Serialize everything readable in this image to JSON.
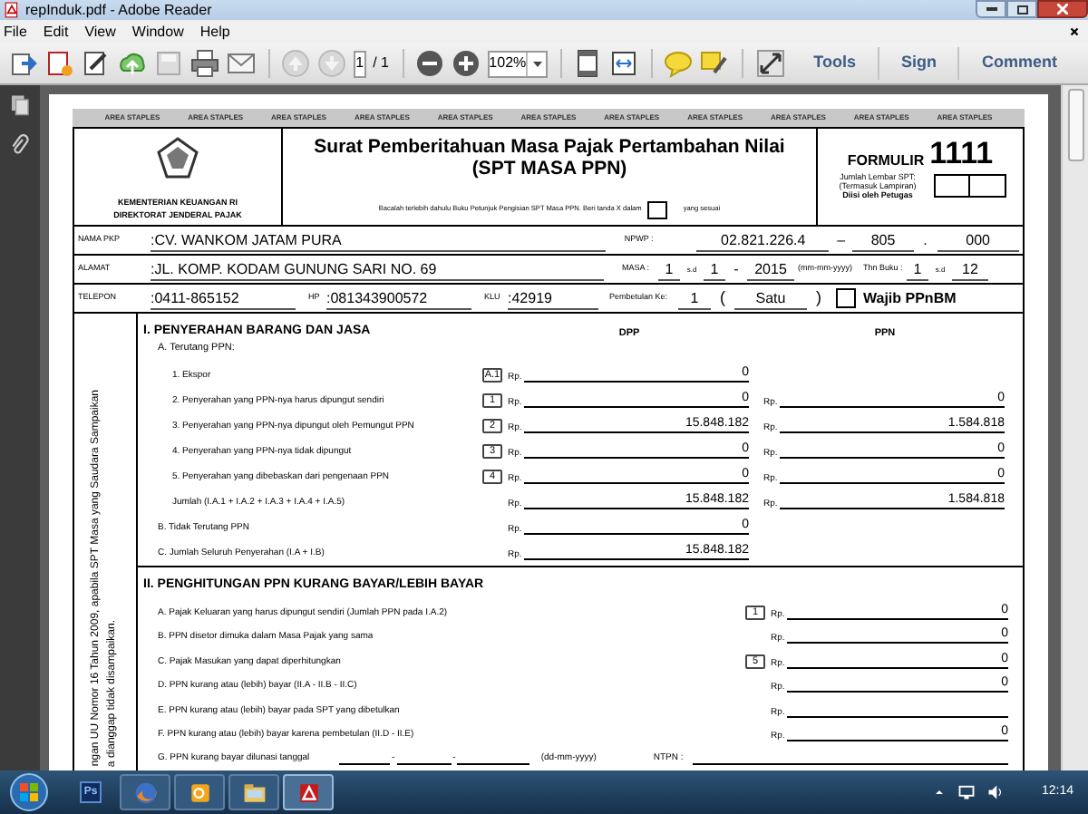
{
  "window": {
    "title": "repInduk.pdf - Adobe Reader"
  },
  "menu": [
    "File",
    "Edit",
    "View",
    "Window",
    "Help"
  ],
  "toolbar": {
    "page": "1",
    "page_total": "/ 1",
    "zoom": "102%",
    "panels": [
      "Tools",
      "Sign",
      "Comment"
    ]
  },
  "form": {
    "staples": [
      "AREA STAPLES",
      "AREA STAPLES",
      "AREA STAPLES",
      "AREA STAPLES",
      "AREA STAPLES",
      "AREA STAPLES",
      "AREA STAPLES",
      "AREA STAPLES",
      "AREA STAPLES",
      "AREA STAPLES",
      "AREA STAPLES"
    ],
    "agency": [
      "KEMENTERIAN KEUANGAN RI",
      "DIREKTORAT JENDERAL PAJAK"
    ],
    "title": "Surat Pemberitahuan Masa Pajak Pertambahan Nilai",
    "subtitle": "(SPT MASA PPN)",
    "instruction": "Bacalah terlebih dahulu Buku Petunjuk Pengisian SPT Masa PPN. Beri tanda X  dalam",
    "instruction_end": "yang sesuai",
    "instruction_box_checked": false,
    "formulir_label": "FORMULIR",
    "formulir_number": "1111",
    "sheets_note": [
      "Jumlah Lembar SPT:",
      "(Termasuk Lampiran)",
      "Diisi oleh Petugas"
    ],
    "identity": {
      "name_label": "NAMA PKP",
      "name": ":CV. WANKOM JATAM PURA",
      "npwp_label": "NPWP :",
      "npwp": [
        "02.821.226.4",
        "–",
        "805",
        ".",
        "000"
      ],
      "address_label": "ALAMAT",
      "address": ":JL. KOMP. KODAM GUNUNG SARI NO. 69",
      "masa_label": "MASA :",
      "masa": [
        "1",
        "s.d",
        "1",
        "-",
        "2015"
      ],
      "masa_format": "(mm-mm-yyyy)",
      "book_year_label": "Thn Buku :",
      "book_year": [
        "1",
        "s.d",
        "12"
      ],
      "phone_label": "TELEPON",
      "phone": ":0411-865152",
      "hp_label": "HP",
      "hp": ":081343900572",
      "klu_label": "KLU",
      "klu": ":42919",
      "revision_label": "Pembetulan Ke:",
      "revision": "1",
      "revision_words": [
        "(",
        "Satu",
        ")"
      ],
      "ppnbm": {
        "label": "Wajib PPnBM",
        "checked": false
      }
    },
    "side_note": [
      "ngan UU Nomor 16 Tahun 2009, apabila SPT Masa yang Saudara Sampaikan",
      "a dianggap tidak disampaikan."
    ],
    "section_1": {
      "heading": "I. PENYERAHAN BARANG DAN JASA",
      "columns": [
        "DPP",
        "PPN"
      ],
      "rows": [
        {
          "kind": "subheading",
          "label": "A. Terutang PPN:"
        },
        {
          "kind": "item",
          "label": "1. Ekspor",
          "code": "A.1",
          "dpp": {
            "prefix": "Rp.",
            "value": "0"
          }
        },
        {
          "kind": "item",
          "label": "2. Penyerahan yang PPN-nya harus dipungut sendiri",
          "code": "1",
          "dpp": {
            "prefix": "Rp.",
            "value": "0"
          },
          "ppn": {
            "prefix": "Rp.",
            "value": "0"
          }
        },
        {
          "kind": "item",
          "label": "3. Penyerahan yang PPN-nya dipungut oleh Pemungut PPN",
          "code": "2",
          "dpp": {
            "prefix": "Rp.",
            "value": "15.848.182"
          },
          "ppn": {
            "prefix": "Rp.",
            "value": "1.584.818"
          }
        },
        {
          "kind": "item",
          "label": "4. Penyerahan yang PPN-nya tidak dipungut",
          "code": "3",
          "dpp": {
            "prefix": "Rp.",
            "value": "0"
          },
          "ppn": {
            "prefix": "Rp.",
            "value": "0"
          }
        },
        {
          "kind": "item",
          "label": "5. Penyerahan yang dibebaskan dari pengenaan PPN",
          "code": "4",
          "dpp": {
            "prefix": "Rp.",
            "value": "0"
          },
          "ppn": {
            "prefix": "Rp.",
            "value": "0"
          }
        },
        {
          "kind": "item",
          "label": "Jumlah (I.A.1 + I.A.2 + I.A.3 + I.A.4 + I.A.5)",
          "dpp": {
            "prefix": "Rp.",
            "value": "15.848.182"
          },
          "ppn": {
            "prefix": "Rp.",
            "value": "1.584.818"
          }
        },
        {
          "kind": "total",
          "label": "B. Tidak Terutang PPN",
          "dpp": {
            "prefix": "Rp.",
            "value": "0"
          }
        },
        {
          "kind": "total",
          "label": "C. Jumlah Seluruh Penyerahan (I.A + I.B)",
          "dpp": {
            "prefix": "Rp.",
            "value": "15.848.182"
          }
        }
      ]
    },
    "section_2": {
      "heading": "II. PENGHITUNGAN PPN KURANG BAYAR/LEBIH BAYAR",
      "rows": [
        {
          "kind": "amount",
          "label": "A. Pajak Keluaran yang harus dipungut sendiri (Jumlah PPN pada I.A.2)",
          "code": "1",
          "amount": {
            "prefix": "Rp.",
            "value": "0"
          }
        },
        {
          "kind": "amount",
          "label": "B. PPN disetor dimuka dalam Masa Pajak yang sama",
          "amount": {
            "prefix": "Rp.",
            "value": "0"
          }
        },
        {
          "kind": "amount",
          "label": "C. Pajak Masukan yang dapat diperhitungkan",
          "code": "5",
          "amount": {
            "prefix": "Rp.",
            "value": "0"
          }
        },
        {
          "kind": "amount",
          "label": "D. PPN kurang atau (lebih) bayar (II.A - II.B - II.C)",
          "amount": {
            "prefix": "Rp.",
            "value": "0"
          }
        },
        {
          "kind": "amount",
          "label": "E. PPN kurang atau (lebih) bayar pada SPT yang dibetulkan",
          "amount": {
            "prefix": "Rp."
          }
        },
        {
          "kind": "amount",
          "label": "F. PPN kurang atau (lebih) bayar karena pembetulan (II.D - II.E)",
          "amount": {
            "prefix": "Rp.",
            "value": "0"
          }
        },
        {
          "kind": "date",
          "label": "G. PPN kurang bayar dilunasi tanggal",
          "separators": [
            "-",
            "-"
          ],
          "date_format": "(dd-mm-yyyy)",
          "ntpn_label": "NTPN :"
        }
      ]
    }
  },
  "taskbar": {
    "pinned_label": "Ps",
    "clock": "12:14"
  }
}
